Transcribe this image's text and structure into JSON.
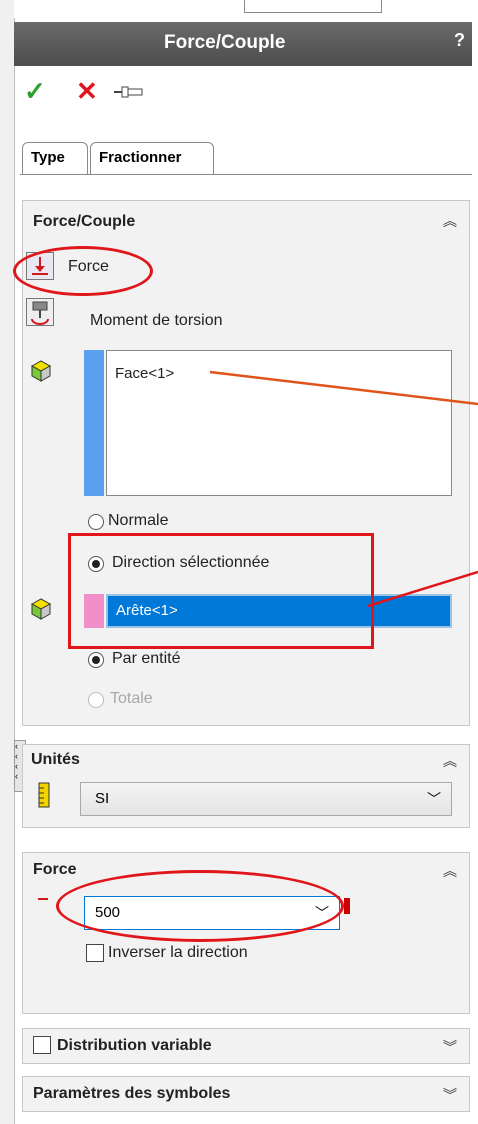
{
  "title": "Force/Couple",
  "help_label": "?",
  "toolbar": {
    "ok_icon": "checkmark-icon",
    "cancel_icon": "x-icon",
    "pin_icon": "pushpin-icon"
  },
  "tabs": [
    {
      "label": "Type",
      "active": true
    },
    {
      "label": "Fractionner",
      "active": false
    }
  ],
  "force_couple_section": {
    "header": "Force/Couple",
    "force_label": "Force",
    "torque_label": "Moment de torsion",
    "faces_list": [
      "Face<1>"
    ],
    "normale_label": "Normale",
    "direction_label": "Direction sélectionnée",
    "direction_value": "Arête<1>",
    "par_entite_label": "Par entité",
    "totale_label": "Totale"
  },
  "units_section": {
    "header": "Unités",
    "value": "SI"
  },
  "force_section": {
    "header": "Force",
    "value": "500",
    "reverse_label": "Inverser la direction"
  },
  "distribution_section": {
    "header": "Distribution variable"
  },
  "symbols_section": {
    "header": "Paramètres des symboles"
  },
  "colors": {
    "annotation_red": "#e0161b",
    "selection_blue": "#0078d7",
    "list_blue": "#5aa0ee",
    "list_pink": "#f08fc8"
  }
}
